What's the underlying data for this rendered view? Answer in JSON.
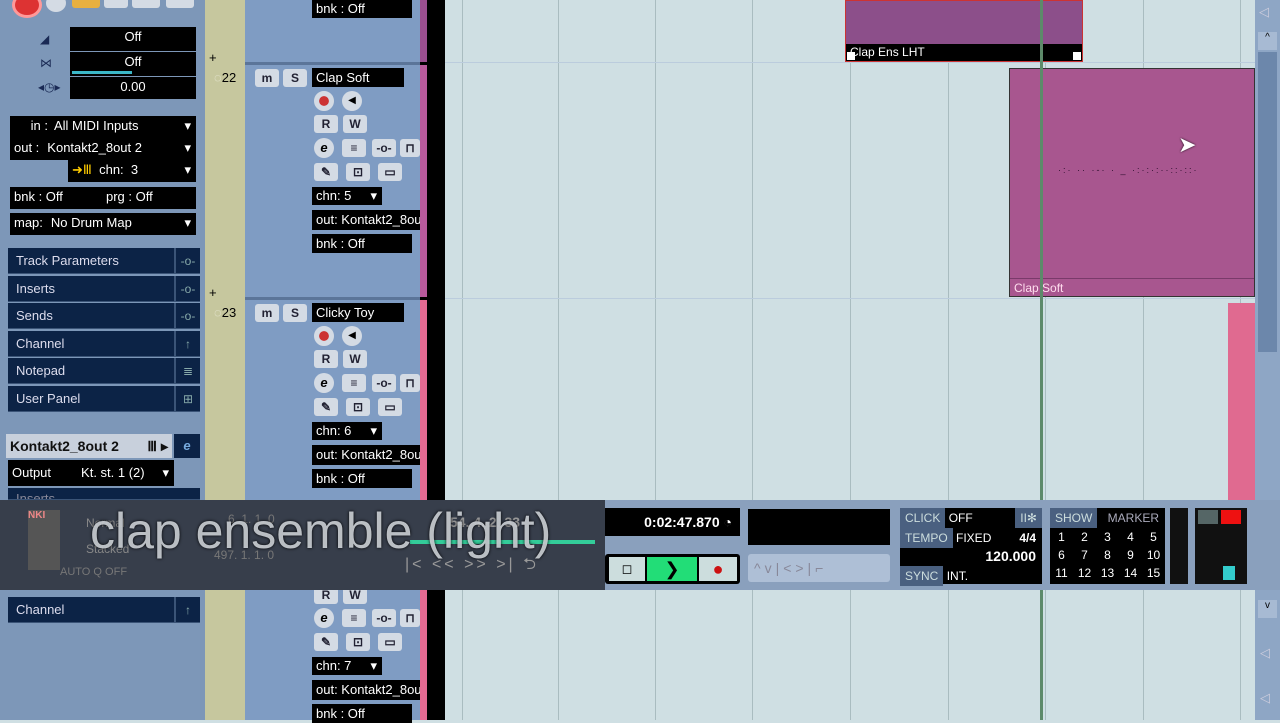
{
  "inspector": {
    "volume": "Off",
    "pan": "Off",
    "delay": "0.00",
    "in": {
      "label": "in :",
      "value": "All MIDI Inputs"
    },
    "out": {
      "label": "out :",
      "value": "Kontakt2_8out 2"
    },
    "chn": {
      "label": "chn:",
      "value": "3"
    },
    "bnk": "bnk : Off",
    "prg": "prg : Off",
    "map": {
      "label": "map:",
      "value": "No Drum Map"
    },
    "sections": [
      "Track Parameters",
      "Inserts",
      "Sends",
      "Channel",
      "Notepad",
      "User Panel"
    ],
    "channel_header": "Kontakt2_8out 2",
    "output": {
      "label": "Output",
      "value": "Kt. st. 1 (2)"
    },
    "inserts_partial": "Inserts",
    "channel_bottom": "Channel"
  },
  "tracks": [
    {
      "number": "",
      "bnk": "bnk : Off"
    },
    {
      "number": "22",
      "name": "Clap Soft",
      "chn": "chn: 5",
      "out": "out: Kontakt2_8out",
      "bnk": "bnk : Off"
    },
    {
      "number": "23",
      "name": "Clicky Toy",
      "chn": "chn: 6",
      "out": "out: Kontakt2_8out",
      "bnk": "bnk : Off"
    },
    {
      "number": "",
      "chn": "chn: 7",
      "out": "out: Kontakt2_8out",
      "bnk": "bnk : Off"
    }
  ],
  "track_buttons": {
    "mute": "m",
    "solo": "S",
    "read": "R",
    "write": "W"
  },
  "parts": [
    {
      "name": "Clap Ens LHT",
      "color": "#8c4f8a"
    },
    {
      "name": "Clap Soft",
      "color": "#a8568f"
    },
    {
      "name": "",
      "color": "#e06a90"
    }
  ],
  "overlay_caption": "clap ensemble (light)",
  "transport": {
    "nki": "NKI",
    "mode1": "Normal",
    "mode2": "Stacked",
    "autoq": "AUTO Q",
    "autoq_val": "OFF",
    "left_locator": "6. 1. 1. 0",
    "right_locator": "497. 1. 1. 0",
    "position_bars": "54. 4. 2. 33",
    "time": "0:02:47.870",
    "click_label": "CLICK",
    "click_value": "OFF",
    "tempo_label": "TEMPO",
    "tempo_mode": "FIXED",
    "signature": "4/4",
    "tempo": "120.000",
    "sync_label": "SYNC",
    "sync_value": "INT.",
    "show_label": "SHOW",
    "marker_label": "MARKER",
    "markers": [
      "1",
      "2",
      "3",
      "4",
      "5",
      "6",
      "7",
      "8",
      "9",
      "10",
      "11",
      "12",
      "13",
      "14",
      "15"
    ],
    "play_color": "#22dd77",
    "record_color": "#cc1111"
  }
}
